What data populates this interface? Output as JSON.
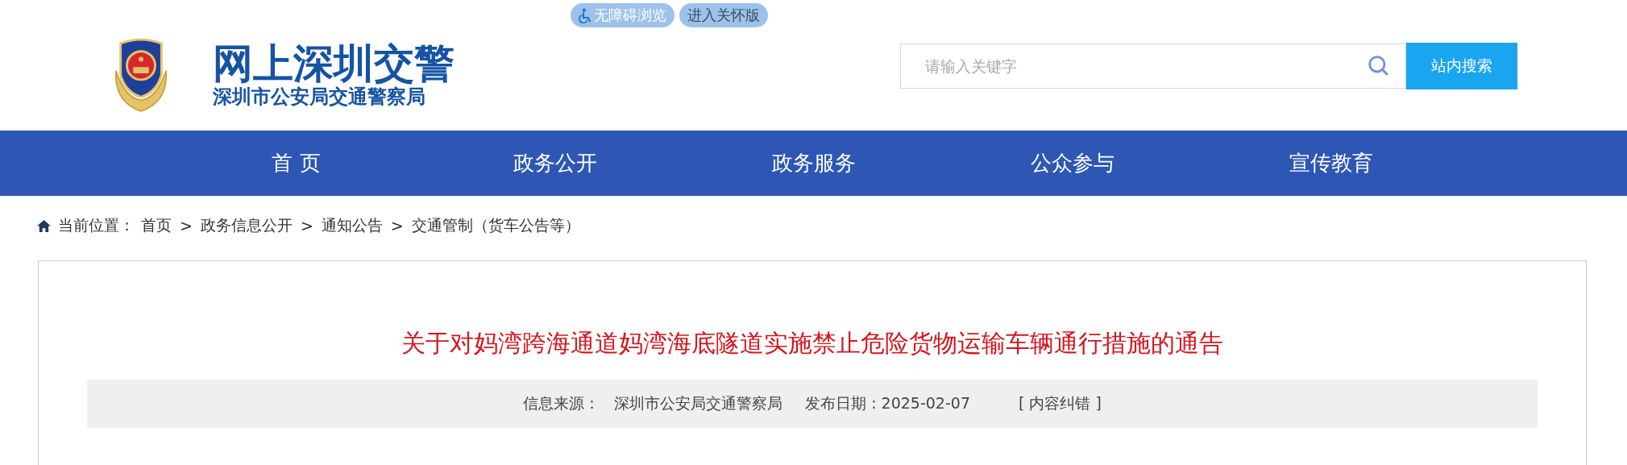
{
  "top_links": [
    {
      "kind": "accessible",
      "label": "无障碍浏览"
    },
    {
      "kind": "plain",
      "label": "进入关怀版"
    }
  ],
  "site": {
    "title": "网上深圳交警",
    "subtitle": "深圳市公安局交通警察局"
  },
  "search": {
    "placeholder": "请输入关键字",
    "button": "站内搜索"
  },
  "nav": [
    {
      "label": "首 页"
    },
    {
      "label": "政务公开"
    },
    {
      "label": "政务服务"
    },
    {
      "label": "公众参与"
    },
    {
      "label": "宣传教育"
    }
  ],
  "breadcrumb": {
    "label": "当前位置：",
    "items": [
      {
        "text": "首页"
      },
      {
        "sep": ">",
        "text": "政务信息公开"
      },
      {
        "sep": ">",
        "text": "通知公告"
      },
      {
        "sep": ">",
        "text": "交通管制（货车公告等）"
      }
    ]
  },
  "article": {
    "title": "关于对妈湾跨海通道妈湾海底隧道实施禁止危险货物运输车辆通行措施的通告",
    "source_label": "信息来源：",
    "source": "深圳市公安局交通警察局",
    "date": "发布日期 : 2025-02-07",
    "report": "[ 内容纠错 ]"
  }
}
